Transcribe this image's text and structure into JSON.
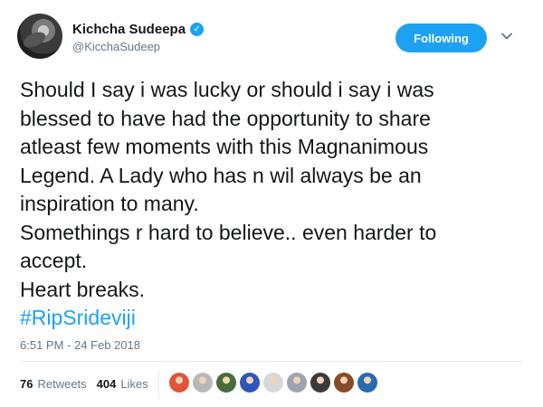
{
  "user": {
    "display_name": "Kichcha Sudeepa",
    "handle": "@KicchaSudeep",
    "verified_icon": "verified-badge-icon",
    "avatar_icon": "profile-avatar"
  },
  "follow_button": {
    "label": "Following",
    "color": "#1da1f2"
  },
  "menu_icon": "chevron-down-icon",
  "tweet": {
    "lines": [
      "Should I say i was lucky or should i say i was",
      "blessed to have had the opportunity to share",
      "atleast few moments with this Magnanimous",
      "Legend. A Lady who has n wil always be an",
      "inspiration to many.",
      "Somethings r hard to believe.. even harder to",
      "accept.",
      "Heart breaks."
    ],
    "hashtag": "#RipSrideviji",
    "hashtag_color": "#1da1f2"
  },
  "timestamp": "6:51 PM - 24 Feb 2018",
  "stats": {
    "retweets_count": "76",
    "retweets_label": "Retweets",
    "likes_count": "404",
    "likes_label": "Likes"
  },
  "likers": [
    {
      "icon": "liker-avatar-icon",
      "color": "#e0543a"
    },
    {
      "icon": "liker-avatar-icon",
      "color": "#b8b8b8"
    },
    {
      "icon": "liker-avatar-icon",
      "color": "#4a6b3a"
    },
    {
      "icon": "liker-avatar-icon",
      "color": "#2e56b8"
    },
    {
      "icon": "liker-avatar-icon",
      "color": "#d8d8d8"
    },
    {
      "icon": "liker-avatar-icon",
      "color": "#9aa5b1"
    },
    {
      "icon": "liker-avatar-icon",
      "color": "#3a3a3a"
    },
    {
      "icon": "liker-avatar-icon",
      "color": "#8a4a2a"
    },
    {
      "icon": "liker-avatar-icon",
      "color": "#2a6bb0"
    }
  ],
  "colors": {
    "text": "#14171a",
    "muted": "#657786",
    "divider": "#e6ecf0"
  }
}
